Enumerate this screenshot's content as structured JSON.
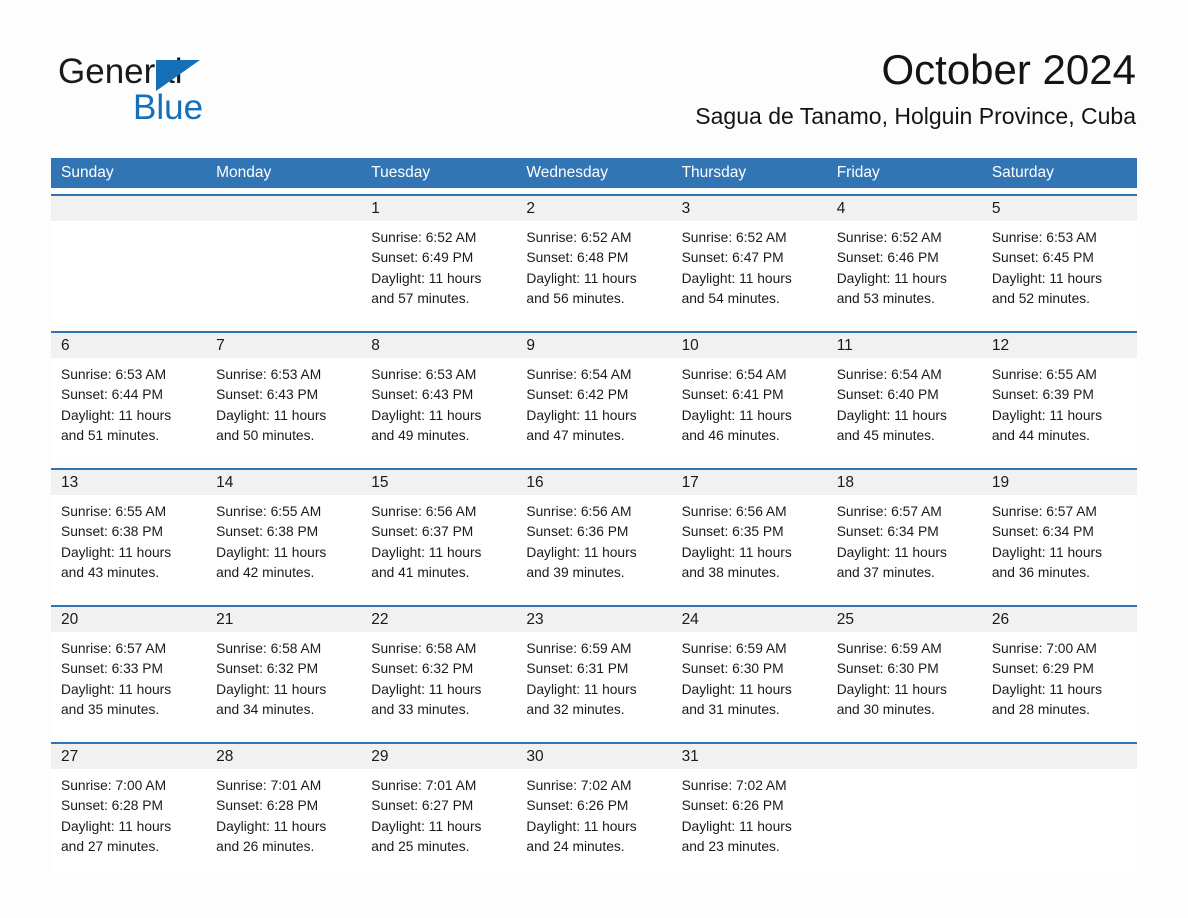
{
  "brand": {
    "word_one": "General",
    "word_two": "Blue",
    "triangle_icon": "blue-triangle-logo-mark",
    "brand_color": "#1470b8"
  },
  "header": {
    "month_title": "October 2024",
    "location": "Sagua de Tanamo, Holguin Province, Cuba"
  },
  "theme": {
    "header_blue": "#3175b4",
    "rule_blue": "#2e74b5",
    "number_band_gray": "#f1f1f1",
    "text_black": "#1a1a1a"
  },
  "weekdays": [
    "Sunday",
    "Monday",
    "Tuesday",
    "Wednesday",
    "Thursday",
    "Friday",
    "Saturday"
  ],
  "weeks": [
    [
      {
        "day": "",
        "sunrise": "",
        "sunset": "",
        "daylight_line1": "",
        "daylight_line2": ""
      },
      {
        "day": "",
        "sunrise": "",
        "sunset": "",
        "daylight_line1": "",
        "daylight_line2": ""
      },
      {
        "day": "1",
        "sunrise": "Sunrise: 6:52 AM",
        "sunset": "Sunset: 6:49 PM",
        "daylight_line1": "Daylight: 11 hours",
        "daylight_line2": "and 57 minutes."
      },
      {
        "day": "2",
        "sunrise": "Sunrise: 6:52 AM",
        "sunset": "Sunset: 6:48 PM",
        "daylight_line1": "Daylight: 11 hours",
        "daylight_line2": "and 56 minutes."
      },
      {
        "day": "3",
        "sunrise": "Sunrise: 6:52 AM",
        "sunset": "Sunset: 6:47 PM",
        "daylight_line1": "Daylight: 11 hours",
        "daylight_line2": "and 54 minutes."
      },
      {
        "day": "4",
        "sunrise": "Sunrise: 6:52 AM",
        "sunset": "Sunset: 6:46 PM",
        "daylight_line1": "Daylight: 11 hours",
        "daylight_line2": "and 53 minutes."
      },
      {
        "day": "5",
        "sunrise": "Sunrise: 6:53 AM",
        "sunset": "Sunset: 6:45 PM",
        "daylight_line1": "Daylight: 11 hours",
        "daylight_line2": "and 52 minutes."
      }
    ],
    [
      {
        "day": "6",
        "sunrise": "Sunrise: 6:53 AM",
        "sunset": "Sunset: 6:44 PM",
        "daylight_line1": "Daylight: 11 hours",
        "daylight_line2": "and 51 minutes."
      },
      {
        "day": "7",
        "sunrise": "Sunrise: 6:53 AM",
        "sunset": "Sunset: 6:43 PM",
        "daylight_line1": "Daylight: 11 hours",
        "daylight_line2": "and 50 minutes."
      },
      {
        "day": "8",
        "sunrise": "Sunrise: 6:53 AM",
        "sunset": "Sunset: 6:43 PM",
        "daylight_line1": "Daylight: 11 hours",
        "daylight_line2": "and 49 minutes."
      },
      {
        "day": "9",
        "sunrise": "Sunrise: 6:54 AM",
        "sunset": "Sunset: 6:42 PM",
        "daylight_line1": "Daylight: 11 hours",
        "daylight_line2": "and 47 minutes."
      },
      {
        "day": "10",
        "sunrise": "Sunrise: 6:54 AM",
        "sunset": "Sunset: 6:41 PM",
        "daylight_line1": "Daylight: 11 hours",
        "daylight_line2": "and 46 minutes."
      },
      {
        "day": "11",
        "sunrise": "Sunrise: 6:54 AM",
        "sunset": "Sunset: 6:40 PM",
        "daylight_line1": "Daylight: 11 hours",
        "daylight_line2": "and 45 minutes."
      },
      {
        "day": "12",
        "sunrise": "Sunrise: 6:55 AM",
        "sunset": "Sunset: 6:39 PM",
        "daylight_line1": "Daylight: 11 hours",
        "daylight_line2": "and 44 minutes."
      }
    ],
    [
      {
        "day": "13",
        "sunrise": "Sunrise: 6:55 AM",
        "sunset": "Sunset: 6:38 PM",
        "daylight_line1": "Daylight: 11 hours",
        "daylight_line2": "and 43 minutes."
      },
      {
        "day": "14",
        "sunrise": "Sunrise: 6:55 AM",
        "sunset": "Sunset: 6:38 PM",
        "daylight_line1": "Daylight: 11 hours",
        "daylight_line2": "and 42 minutes."
      },
      {
        "day": "15",
        "sunrise": "Sunrise: 6:56 AM",
        "sunset": "Sunset: 6:37 PM",
        "daylight_line1": "Daylight: 11 hours",
        "daylight_line2": "and 41 minutes."
      },
      {
        "day": "16",
        "sunrise": "Sunrise: 6:56 AM",
        "sunset": "Sunset: 6:36 PM",
        "daylight_line1": "Daylight: 11 hours",
        "daylight_line2": "and 39 minutes."
      },
      {
        "day": "17",
        "sunrise": "Sunrise: 6:56 AM",
        "sunset": "Sunset: 6:35 PM",
        "daylight_line1": "Daylight: 11 hours",
        "daylight_line2": "and 38 minutes."
      },
      {
        "day": "18",
        "sunrise": "Sunrise: 6:57 AM",
        "sunset": "Sunset: 6:34 PM",
        "daylight_line1": "Daylight: 11 hours",
        "daylight_line2": "and 37 minutes."
      },
      {
        "day": "19",
        "sunrise": "Sunrise: 6:57 AM",
        "sunset": "Sunset: 6:34 PM",
        "daylight_line1": "Daylight: 11 hours",
        "daylight_line2": "and 36 minutes."
      }
    ],
    [
      {
        "day": "20",
        "sunrise": "Sunrise: 6:57 AM",
        "sunset": "Sunset: 6:33 PM",
        "daylight_line1": "Daylight: 11 hours",
        "daylight_line2": "and 35 minutes."
      },
      {
        "day": "21",
        "sunrise": "Sunrise: 6:58 AM",
        "sunset": "Sunset: 6:32 PM",
        "daylight_line1": "Daylight: 11 hours",
        "daylight_line2": "and 34 minutes."
      },
      {
        "day": "22",
        "sunrise": "Sunrise: 6:58 AM",
        "sunset": "Sunset: 6:32 PM",
        "daylight_line1": "Daylight: 11 hours",
        "daylight_line2": "and 33 minutes."
      },
      {
        "day": "23",
        "sunrise": "Sunrise: 6:59 AM",
        "sunset": "Sunset: 6:31 PM",
        "daylight_line1": "Daylight: 11 hours",
        "daylight_line2": "and 32 minutes."
      },
      {
        "day": "24",
        "sunrise": "Sunrise: 6:59 AM",
        "sunset": "Sunset: 6:30 PM",
        "daylight_line1": "Daylight: 11 hours",
        "daylight_line2": "and 31 minutes."
      },
      {
        "day": "25",
        "sunrise": "Sunrise: 6:59 AM",
        "sunset": "Sunset: 6:30 PM",
        "daylight_line1": "Daylight: 11 hours",
        "daylight_line2": "and 30 minutes."
      },
      {
        "day": "26",
        "sunrise": "Sunrise: 7:00 AM",
        "sunset": "Sunset: 6:29 PM",
        "daylight_line1": "Daylight: 11 hours",
        "daylight_line2": "and 28 minutes."
      }
    ],
    [
      {
        "day": "27",
        "sunrise": "Sunrise: 7:00 AM",
        "sunset": "Sunset: 6:28 PM",
        "daylight_line1": "Daylight: 11 hours",
        "daylight_line2": "and 27 minutes."
      },
      {
        "day": "28",
        "sunrise": "Sunrise: 7:01 AM",
        "sunset": "Sunset: 6:28 PM",
        "daylight_line1": "Daylight: 11 hours",
        "daylight_line2": "and 26 minutes."
      },
      {
        "day": "29",
        "sunrise": "Sunrise: 7:01 AM",
        "sunset": "Sunset: 6:27 PM",
        "daylight_line1": "Daylight: 11 hours",
        "daylight_line2": "and 25 minutes."
      },
      {
        "day": "30",
        "sunrise": "Sunrise: 7:02 AM",
        "sunset": "Sunset: 6:26 PM",
        "daylight_line1": "Daylight: 11 hours",
        "daylight_line2": "and 24 minutes."
      },
      {
        "day": "31",
        "sunrise": "Sunrise: 7:02 AM",
        "sunset": "Sunset: 6:26 PM",
        "daylight_line1": "Daylight: 11 hours",
        "daylight_line2": "and 23 minutes."
      },
      {
        "day": "",
        "sunrise": "",
        "sunset": "",
        "daylight_line1": "",
        "daylight_line2": ""
      },
      {
        "day": "",
        "sunrise": "",
        "sunset": "",
        "daylight_line1": "",
        "daylight_line2": ""
      }
    ]
  ]
}
